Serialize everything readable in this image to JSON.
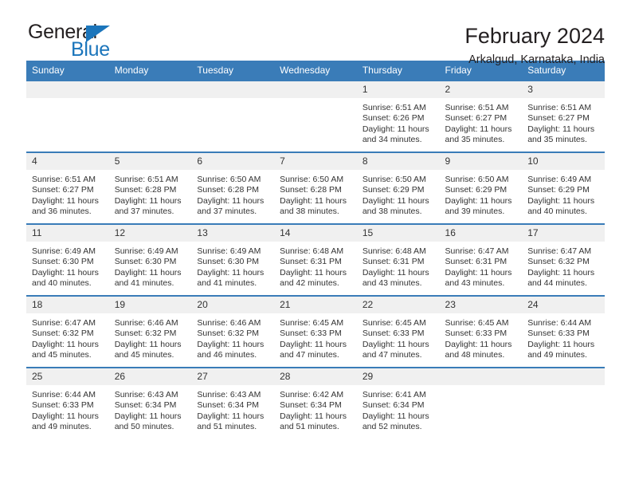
{
  "logo": {
    "word_one": "General",
    "word_two": "Blue",
    "triangle_color": "#1b75bb"
  },
  "header": {
    "title": "February 2024",
    "subtitle": "Arkalgud, Karnataka, India",
    "accent_color": "#3a7cb8",
    "daynum_band_color": "#f0f0f0"
  },
  "calendar": {
    "weekday_headers": [
      "Sunday",
      "Monday",
      "Tuesday",
      "Wednesday",
      "Thursday",
      "Friday",
      "Saturday"
    ],
    "weeks": [
      [
        {
          "day": "",
          "blank": true
        },
        {
          "day": "",
          "blank": true
        },
        {
          "day": "",
          "blank": true
        },
        {
          "day": "",
          "blank": true
        },
        {
          "day": "1",
          "sunrise": "Sunrise: 6:51 AM",
          "sunset": "Sunset: 6:26 PM",
          "daylight_line1": "Daylight: 11 hours",
          "daylight_line2": "and 34 minutes."
        },
        {
          "day": "2",
          "sunrise": "Sunrise: 6:51 AM",
          "sunset": "Sunset: 6:27 PM",
          "daylight_line1": "Daylight: 11 hours",
          "daylight_line2": "and 35 minutes."
        },
        {
          "day": "3",
          "sunrise": "Sunrise: 6:51 AM",
          "sunset": "Sunset: 6:27 PM",
          "daylight_line1": "Daylight: 11 hours",
          "daylight_line2": "and 35 minutes."
        }
      ],
      [
        {
          "day": "4",
          "sunrise": "Sunrise: 6:51 AM",
          "sunset": "Sunset: 6:27 PM",
          "daylight_line1": "Daylight: 11 hours",
          "daylight_line2": "and 36 minutes."
        },
        {
          "day": "5",
          "sunrise": "Sunrise: 6:51 AM",
          "sunset": "Sunset: 6:28 PM",
          "daylight_line1": "Daylight: 11 hours",
          "daylight_line2": "and 37 minutes."
        },
        {
          "day": "6",
          "sunrise": "Sunrise: 6:50 AM",
          "sunset": "Sunset: 6:28 PM",
          "daylight_line1": "Daylight: 11 hours",
          "daylight_line2": "and 37 minutes."
        },
        {
          "day": "7",
          "sunrise": "Sunrise: 6:50 AM",
          "sunset": "Sunset: 6:28 PM",
          "daylight_line1": "Daylight: 11 hours",
          "daylight_line2": "and 38 minutes."
        },
        {
          "day": "8",
          "sunrise": "Sunrise: 6:50 AM",
          "sunset": "Sunset: 6:29 PM",
          "daylight_line1": "Daylight: 11 hours",
          "daylight_line2": "and 38 minutes."
        },
        {
          "day": "9",
          "sunrise": "Sunrise: 6:50 AM",
          "sunset": "Sunset: 6:29 PM",
          "daylight_line1": "Daylight: 11 hours",
          "daylight_line2": "and 39 minutes."
        },
        {
          "day": "10",
          "sunrise": "Sunrise: 6:49 AM",
          "sunset": "Sunset: 6:29 PM",
          "daylight_line1": "Daylight: 11 hours",
          "daylight_line2": "and 40 minutes."
        }
      ],
      [
        {
          "day": "11",
          "sunrise": "Sunrise: 6:49 AM",
          "sunset": "Sunset: 6:30 PM",
          "daylight_line1": "Daylight: 11 hours",
          "daylight_line2": "and 40 minutes."
        },
        {
          "day": "12",
          "sunrise": "Sunrise: 6:49 AM",
          "sunset": "Sunset: 6:30 PM",
          "daylight_line1": "Daylight: 11 hours",
          "daylight_line2": "and 41 minutes."
        },
        {
          "day": "13",
          "sunrise": "Sunrise: 6:49 AM",
          "sunset": "Sunset: 6:30 PM",
          "daylight_line1": "Daylight: 11 hours",
          "daylight_line2": "and 41 minutes."
        },
        {
          "day": "14",
          "sunrise": "Sunrise: 6:48 AM",
          "sunset": "Sunset: 6:31 PM",
          "daylight_line1": "Daylight: 11 hours",
          "daylight_line2": "and 42 minutes."
        },
        {
          "day": "15",
          "sunrise": "Sunrise: 6:48 AM",
          "sunset": "Sunset: 6:31 PM",
          "daylight_line1": "Daylight: 11 hours",
          "daylight_line2": "and 43 minutes."
        },
        {
          "day": "16",
          "sunrise": "Sunrise: 6:47 AM",
          "sunset": "Sunset: 6:31 PM",
          "daylight_line1": "Daylight: 11 hours",
          "daylight_line2": "and 43 minutes."
        },
        {
          "day": "17",
          "sunrise": "Sunrise: 6:47 AM",
          "sunset": "Sunset: 6:32 PM",
          "daylight_line1": "Daylight: 11 hours",
          "daylight_line2": "and 44 minutes."
        }
      ],
      [
        {
          "day": "18",
          "sunrise": "Sunrise: 6:47 AM",
          "sunset": "Sunset: 6:32 PM",
          "daylight_line1": "Daylight: 11 hours",
          "daylight_line2": "and 45 minutes."
        },
        {
          "day": "19",
          "sunrise": "Sunrise: 6:46 AM",
          "sunset": "Sunset: 6:32 PM",
          "daylight_line1": "Daylight: 11 hours",
          "daylight_line2": "and 45 minutes."
        },
        {
          "day": "20",
          "sunrise": "Sunrise: 6:46 AM",
          "sunset": "Sunset: 6:32 PM",
          "daylight_line1": "Daylight: 11 hours",
          "daylight_line2": "and 46 minutes."
        },
        {
          "day": "21",
          "sunrise": "Sunrise: 6:45 AM",
          "sunset": "Sunset: 6:33 PM",
          "daylight_line1": "Daylight: 11 hours",
          "daylight_line2": "and 47 minutes."
        },
        {
          "day": "22",
          "sunrise": "Sunrise: 6:45 AM",
          "sunset": "Sunset: 6:33 PM",
          "daylight_line1": "Daylight: 11 hours",
          "daylight_line2": "and 47 minutes."
        },
        {
          "day": "23",
          "sunrise": "Sunrise: 6:45 AM",
          "sunset": "Sunset: 6:33 PM",
          "daylight_line1": "Daylight: 11 hours",
          "daylight_line2": "and 48 minutes."
        },
        {
          "day": "24",
          "sunrise": "Sunrise: 6:44 AM",
          "sunset": "Sunset: 6:33 PM",
          "daylight_line1": "Daylight: 11 hours",
          "daylight_line2": "and 49 minutes."
        }
      ],
      [
        {
          "day": "25",
          "sunrise": "Sunrise: 6:44 AM",
          "sunset": "Sunset: 6:33 PM",
          "daylight_line1": "Daylight: 11 hours",
          "daylight_line2": "and 49 minutes."
        },
        {
          "day": "26",
          "sunrise": "Sunrise: 6:43 AM",
          "sunset": "Sunset: 6:34 PM",
          "daylight_line1": "Daylight: 11 hours",
          "daylight_line2": "and 50 minutes."
        },
        {
          "day": "27",
          "sunrise": "Sunrise: 6:43 AM",
          "sunset": "Sunset: 6:34 PM",
          "daylight_line1": "Daylight: 11 hours",
          "daylight_line2": "and 51 minutes."
        },
        {
          "day": "28",
          "sunrise": "Sunrise: 6:42 AM",
          "sunset": "Sunset: 6:34 PM",
          "daylight_line1": "Daylight: 11 hours",
          "daylight_line2": "and 51 minutes."
        },
        {
          "day": "29",
          "sunrise": "Sunrise: 6:41 AM",
          "sunset": "Sunset: 6:34 PM",
          "daylight_line1": "Daylight: 11 hours",
          "daylight_line2": "and 52 minutes."
        },
        {
          "day": "",
          "blank": true
        },
        {
          "day": "",
          "blank": true
        }
      ]
    ]
  }
}
